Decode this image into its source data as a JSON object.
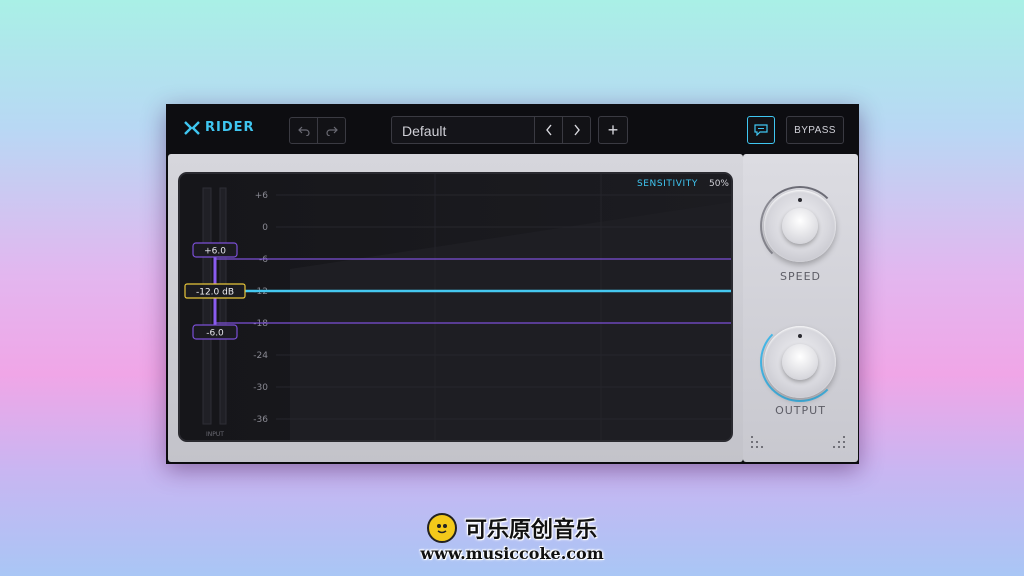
{
  "app": {
    "name": "RIDER"
  },
  "toolbar": {
    "preset_name": "Default",
    "add_label": "+",
    "bypass_label": "BYPASS"
  },
  "display": {
    "sensitivity_label": "SENSITIVITY",
    "sensitivity_value": "50%",
    "scale": [
      "+6",
      "0",
      "-6",
      "-12",
      "-18",
      "-24",
      "-30",
      "-36"
    ],
    "input_label": "INPUT",
    "upper_range": "+6.0",
    "target": "-12.0 dB",
    "lower_range": "-6.0",
    "target_db": -12,
    "upper_line_db": -6,
    "lower_line_db": -18
  },
  "knobs": {
    "speed_label": "SPEED",
    "output_label": "OUTPUT"
  },
  "watermark": {
    "title": "可乐原创音乐",
    "url": "www.musiccoke.com"
  },
  "colors": {
    "accent": "#3fc6f1",
    "range_purple": "#7b4fd6",
    "target_yellow": "#e8c53a"
  }
}
